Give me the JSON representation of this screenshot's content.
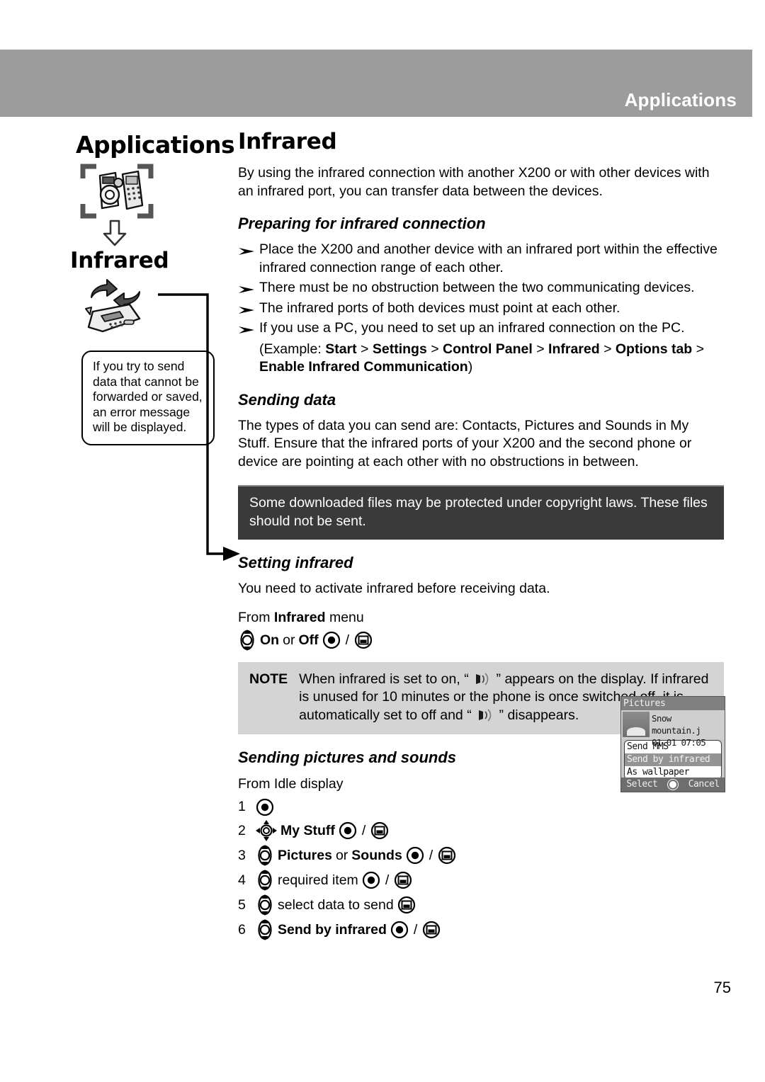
{
  "header": {
    "running_title": "Applications"
  },
  "sidebar": {
    "chapter_title": "Applications",
    "section_title": "Infrared",
    "icons": [
      "camera-phone-pairing-icon",
      "down-arrow-icon",
      "infrared-phone-exchange-icon"
    ],
    "callout": "If you try to send data that cannot be forwarded or saved, an error message will be displayed."
  },
  "main": {
    "title": "Infrared",
    "intro": "By using the infrared connection with another X200 or with other devices with an infrared port, you can transfer data between the devices.",
    "preparing": {
      "heading": "Preparing for infrared connection",
      "bullets": [
        "Place the X200 and another device with an infrared port within the effective infrared connection range of each other.",
        "There must be no obstruction between the two communicating devices.",
        "The infrared ports of both devices must point at each other.",
        "If you use a PC, you need to set up an infrared connection on the PC."
      ],
      "example_prefix": "(Example: ",
      "example_path": [
        "Start",
        "Settings",
        "Control Panel",
        "Infrared",
        "Options tab",
        "Enable Infrared Communication"
      ],
      "example_separator": " > ",
      "example_suffix": ")"
    },
    "sending_data": {
      "heading": "Sending data",
      "body": "The types of data you can send are: Contacts, Pictures and Sounds in My Stuff. Ensure that the infrared ports of your X200 and the second phone or device are pointing at each other with no obstructions in between.",
      "warning": "Some downloaded files may be protected under copyright laws. These files should not be sent."
    },
    "setting_infrared": {
      "heading": "Setting infrared",
      "body": "You need to activate infrared before receiving data.",
      "from_prefix": "From ",
      "from_bold": "Infrared",
      "from_suffix": " menu",
      "option_on": "On",
      "option_or": " or ",
      "option_off": "Off",
      "slash": "/"
    },
    "note": {
      "label": "NOTE",
      "text_part1": "When infrared is set to on, “",
      "icon1": "infrared-indicator-icon",
      "text_part2": "” appears on the display. If infrared is unused for 10 minutes or the phone is once switched off, it is automatically set to off and “",
      "icon2": "infrared-indicator-icon",
      "text_part3": "” disappears."
    },
    "sending_pictures": {
      "heading": "Sending pictures and sounds",
      "from_line": "From Idle display",
      "steps": [
        {
          "num": "1",
          "nav": "none",
          "label": "",
          "bold": false,
          "keys": [
            "select"
          ]
        },
        {
          "num": "2",
          "nav": "four-way",
          "label": "My Stuff",
          "bold": true,
          "keys": [
            "select",
            "softkey"
          ]
        },
        {
          "num": "3",
          "nav": "up-down",
          "label": "Pictures or Sounds",
          "bold": true,
          "keys": [
            "select",
            "softkey"
          ]
        },
        {
          "num": "4",
          "nav": "up-down",
          "label": "required item",
          "bold": false,
          "keys": [
            "select",
            "softkey"
          ]
        },
        {
          "num": "5",
          "nav": "up-down",
          "label": "select data to send",
          "bold": false,
          "keys": [
            "softkey"
          ]
        },
        {
          "num": "6",
          "nav": "up-down",
          "label": "Send by infrared",
          "bold": true,
          "keys": [
            "select",
            "softkey"
          ]
        }
      ],
      "step3_label_bold_a": "Pictures",
      "step3_label_mid": " or ",
      "step3_label_bold_b": "Sounds"
    }
  },
  "phone_screenshot": {
    "title": "Pictures",
    "file_name": "Snow mountain.j",
    "file_date": "01.01 07:05",
    "menu_items": [
      "Send MMS",
      "Send by infrared",
      "As wallpaper"
    ],
    "selected_menu_item": "Send by infrared",
    "softkey_left": "Select",
    "softkey_right": "Cancel",
    "center_key": "select-key-icon"
  },
  "page_number": "75",
  "colors": {
    "header_band": "#9c9c9c",
    "warning_box": "#3a3a3a",
    "note_box": "#d4d4d4",
    "text": "#000000"
  }
}
